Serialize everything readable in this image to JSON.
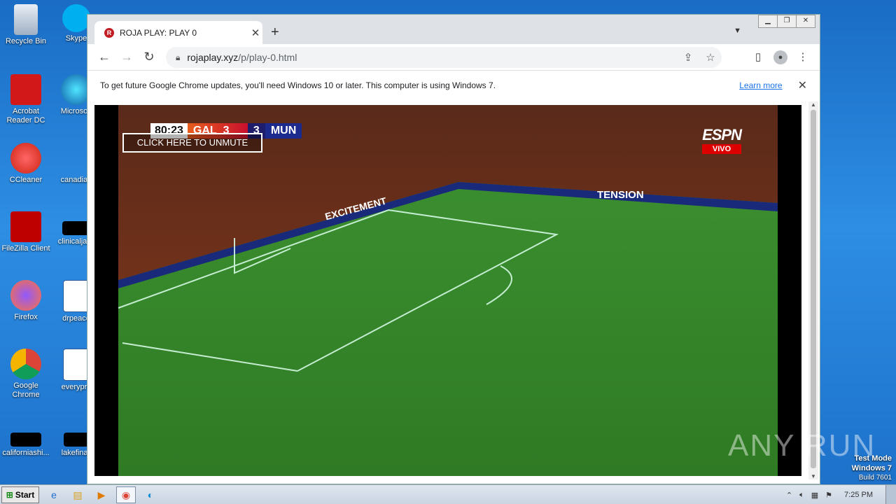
{
  "desktop": {
    "icons": [
      {
        "label": "Recycle Bin"
      },
      {
        "label": "Skype"
      },
      {
        "label": "Acrobat Reader DC"
      },
      {
        "label": "Microsoft"
      },
      {
        "label": "CCleaner"
      },
      {
        "label": "canadian"
      },
      {
        "label": "FileZilla Client"
      },
      {
        "label": "clinicaljack"
      },
      {
        "label": "Firefox"
      },
      {
        "label": "drpeace"
      },
      {
        "label": "Google Chrome"
      },
      {
        "label": "everypre"
      },
      {
        "label": "californiashi..."
      },
      {
        "label": "lakefinall"
      }
    ]
  },
  "browser": {
    "tab_title": "ROJA PLAY: PLAY 0",
    "url_host": "rojaplay.xyz",
    "url_path": "/p/play-0.html",
    "infobar_message": "To get future Google Chrome updates, you'll need Windows 10 or later. This computer is using Windows 7.",
    "infobar_link": "Learn more"
  },
  "video": {
    "clock": "80:23",
    "home_team": "GAL",
    "home_score": "3",
    "away_score": "3",
    "away_team": "MUN",
    "unmute_label": "CLICK HERE TO UNMUTE",
    "broadcaster": "ESPN",
    "broadcaster_tag": "VIVO",
    "board_texts": [
      "EXCITEMENT",
      "TENSION"
    ]
  },
  "watermark": "ANY RUN",
  "system": {
    "test_mode_line1": "Test Mode",
    "test_mode_line2": "Windows 7",
    "test_mode_line3": "Build 7601",
    "start_label": "Start",
    "time": "7:25 PM"
  },
  "colors": {
    "chrome_accent": "#1a73e8",
    "pitch": "#3a8a2e",
    "desktop_bg": "#1a6cc4"
  }
}
